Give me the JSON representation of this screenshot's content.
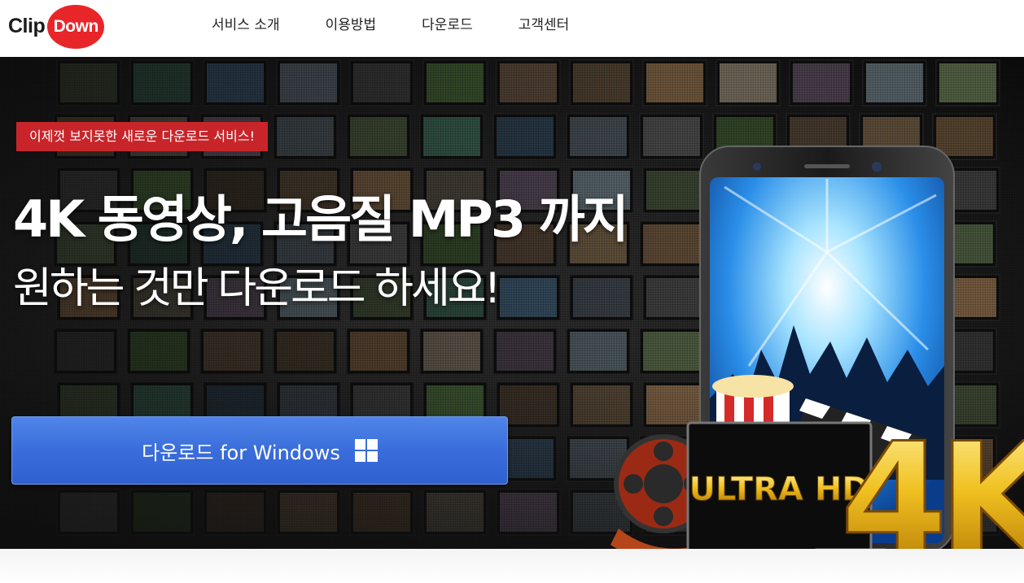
{
  "brand": {
    "logo_left": "Clip",
    "logo_right": "Down",
    "logo_color": "#e8262a"
  },
  "nav": {
    "items": [
      {
        "label": "서비스 소개"
      },
      {
        "label": "이용방법"
      },
      {
        "label": "다운로드"
      },
      {
        "label": "고객센터"
      }
    ]
  },
  "hero": {
    "badge": "이제껏 보지못한 새로운 다운로드 서비스!",
    "badge_color": "#c8252a",
    "headline": "4K 동영상, 고음질 MP3 까지",
    "subline": "원하는 것만 다운로드 하세요!",
    "download_button": {
      "label": "다운로드 for Windows",
      "icon": "windows-icon",
      "color": "#3a6ddb"
    },
    "art": {
      "panel_text": "ULTRA HD",
      "big_text": "4K"
    }
  }
}
